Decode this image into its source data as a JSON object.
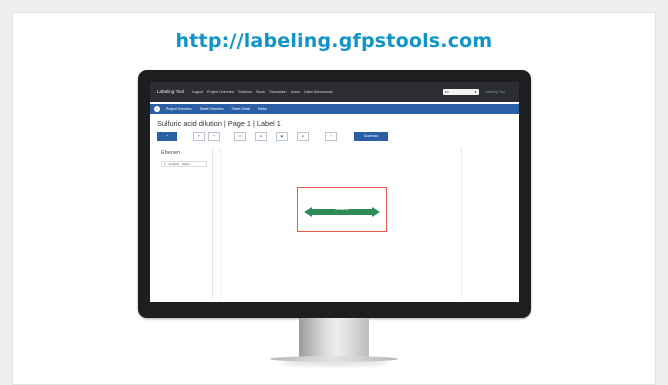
{
  "promo": {
    "url": "http://labeling.gfpstools.com",
    "accent": "#0f95c8"
  },
  "app": {
    "brand": "Labeling Tool",
    "menu": [
      "Logout",
      "Project Overview",
      "Sections",
      "Stock",
      "Translation",
      "Users",
      "Label Dimensions"
    ],
    "language": "en",
    "user": "Labeling Tool",
    "breadcrumbs": [
      "Project Overview",
      "Sheet Overview",
      "Sheet Detail",
      "Editor"
    ],
    "page_title": "Sulfuric acid dilution | Page 1 | Label 1",
    "toolbar": {
      "add": "+",
      "undo": "↶",
      "redo": "↷",
      "tool1": "⊡",
      "tool2": "⊞",
      "tool3": "▣",
      "tool4": "⊟",
      "tool5": "+",
      "action": "Download"
    },
    "sidebar": {
      "title": "Ebenen",
      "layer": "1 · Vorstufe · Water"
    },
    "label": {
      "text": "Water",
      "fill": "#2e8b57",
      "frame": "#e8584a"
    },
    "colors": {
      "topbar": "#2b2d33",
      "navbar": "#2a5fa6"
    }
  }
}
